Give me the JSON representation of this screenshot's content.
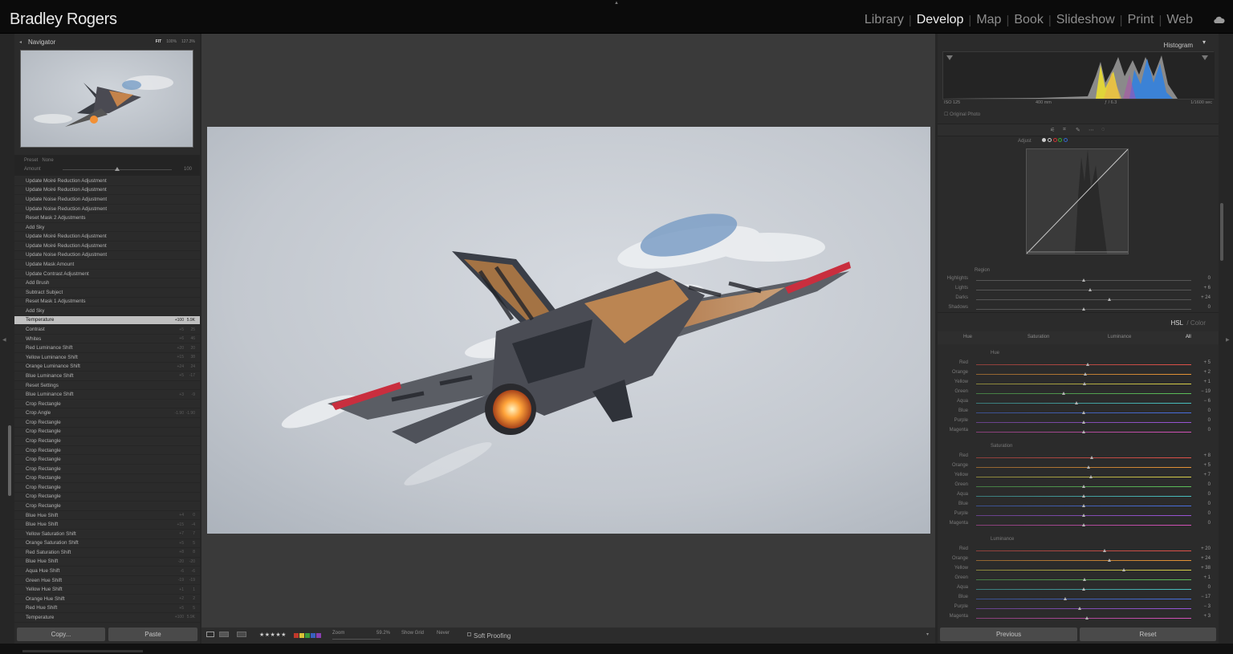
{
  "identity": "Bradley Rogers",
  "modules": [
    {
      "label": "Library",
      "active": false
    },
    {
      "label": "Develop",
      "active": true
    },
    {
      "label": "Map",
      "active": false
    },
    {
      "label": "Book",
      "active": false
    },
    {
      "label": "Slideshow",
      "active": false
    },
    {
      "label": "Print",
      "active": false
    },
    {
      "label": "Web",
      "active": false
    }
  ],
  "navigator": {
    "title": "Navigator",
    "fit": "FIT",
    "zoom1": "100%",
    "zoom2": "127.3%"
  },
  "preset": {
    "label": "Preset",
    "value": "None",
    "amount_label": "Amount",
    "amount_value": "100",
    "amount_fraction": 0.5
  },
  "history": [
    {
      "label": "Update Moiré Reduction Adjustment"
    },
    {
      "label": "Update Moiré Reduction Adjustment"
    },
    {
      "label": "Update Noise Reduction Adjustment"
    },
    {
      "label": "Update Noise Reduction Adjustment"
    },
    {
      "label": "Reset Mask 2 Adjustments"
    },
    {
      "label": "Add Sky"
    },
    {
      "label": "Update Moiré Reduction Adjustment"
    },
    {
      "label": "Update Moiré Reduction Adjustment"
    },
    {
      "label": "Update Noise Reduction Adjustment"
    },
    {
      "label": "Update Mask Amount"
    },
    {
      "label": "Update Contrast Adjustment"
    },
    {
      "label": "Add Brush"
    },
    {
      "label": "Subtract Subject"
    },
    {
      "label": "Reset Mask 1 Adjustments"
    },
    {
      "label": "Add Sky"
    },
    {
      "label": "Temperature",
      "v1": "+100",
      "v2": "5.9K",
      "selected": true
    },
    {
      "label": "Contrast",
      "v1": "+5",
      "v2": "25"
    },
    {
      "label": "Whites",
      "v1": "+6",
      "v2": "46"
    },
    {
      "label": "Red Luminance Shift",
      "v1": "+20",
      "v2": "20"
    },
    {
      "label": "Yellow Luminance Shift",
      "v1": "+15",
      "v2": "38"
    },
    {
      "label": "Orange Luminance Shift",
      "v1": "+24",
      "v2": "24"
    },
    {
      "label": "Blue Luminance Shift",
      "v1": "+5",
      "v2": "-17"
    },
    {
      "label": "Reset Settings"
    },
    {
      "label": "Blue Luminance Shift",
      "v1": "+3",
      "v2": "-9"
    },
    {
      "label": "Crop Rectangle"
    },
    {
      "label": "Crop Angle",
      "v1": "-1.90",
      "v2": "-1.90"
    },
    {
      "label": "Crop Rectangle"
    },
    {
      "label": "Crop Rectangle"
    },
    {
      "label": "Crop Rectangle"
    },
    {
      "label": "Crop Rectangle"
    },
    {
      "label": "Crop Rectangle"
    },
    {
      "label": "Crop Rectangle"
    },
    {
      "label": "Crop Rectangle"
    },
    {
      "label": "Crop Rectangle"
    },
    {
      "label": "Crop Rectangle"
    },
    {
      "label": "Crop Rectangle"
    },
    {
      "label": "Blue Hue Shift",
      "v1": "+4",
      "v2": "0"
    },
    {
      "label": "Blue Hue Shift",
      "v1": "+15",
      "v2": "-4"
    },
    {
      "label": "Yellow Saturation Shift",
      "v1": "+7",
      "v2": "7"
    },
    {
      "label": "Orange Saturation Shift",
      "v1": "+5",
      "v2": "5"
    },
    {
      "label": "Red Saturation Shift",
      "v1": "+8",
      "v2": "8"
    },
    {
      "label": "Blue Hue Shift",
      "v1": "-20",
      "v2": "-20"
    },
    {
      "label": "Aqua Hue Shift",
      "v1": "-6",
      "v2": "-6"
    },
    {
      "label": "Green Hue Shift",
      "v1": "-19",
      "v2": "-19"
    },
    {
      "label": "Yellow Hue Shift",
      "v1": "+1",
      "v2": "1"
    },
    {
      "label": "Orange Hue Shift",
      "v1": "+2",
      "v2": "2"
    },
    {
      "label": "Red Hue Shift",
      "v1": "+5",
      "v2": "5"
    },
    {
      "label": "Temperature",
      "v1": "+100",
      "v2": "5.9K"
    }
  ],
  "buttons": {
    "copy": "Copy...",
    "paste": "Paste",
    "previous": "Previous",
    "reset": "Reset"
  },
  "histogram": {
    "title": "Histogram",
    "iso": "ISO 125",
    "focal": "400 mm",
    "aperture": "ƒ / 6.3",
    "shutter": "1/1600 sec",
    "original_photo": "Original Photo"
  },
  "tone_curve": {
    "adjust": "Adjust",
    "region": "Region",
    "sliders": [
      {
        "label": "Highlights",
        "value": "0",
        "pos": 0.5
      },
      {
        "label": "Lights",
        "value": "+ 6",
        "pos": 0.53
      },
      {
        "label": "Darks",
        "value": "+ 24",
        "pos": 0.62
      },
      {
        "label": "Shadows",
        "value": "0",
        "pos": 0.5
      }
    ]
  },
  "hsl": {
    "title": "HSL",
    "sep": " / ",
    "alt": "Color",
    "tabs": [
      "Hue",
      "Saturation",
      "Luminance",
      "All"
    ],
    "groups": [
      {
        "name": "Hue",
        "rows": [
          {
            "label": "Red",
            "value": "+ 5",
            "pos": 0.52,
            "color": "#e0524a"
          },
          {
            "label": "Orange",
            "value": "+ 2",
            "pos": 0.51,
            "color": "#e79436"
          },
          {
            "label": "Yellow",
            "value": "+ 1",
            "pos": 0.505,
            "color": "#d9d04a"
          },
          {
            "label": "Green",
            "value": "− 19",
            "pos": 0.41,
            "color": "#5cc05a"
          },
          {
            "label": "Aqua",
            "value": "− 6",
            "pos": 0.47,
            "color": "#49c0c0"
          },
          {
            "label": "Blue",
            "value": "0",
            "pos": 0.5,
            "color": "#4a6fe0"
          },
          {
            "label": "Purple",
            "value": "0",
            "pos": 0.5,
            "color": "#9a55d8"
          },
          {
            "label": "Magenta",
            "value": "0",
            "pos": 0.5,
            "color": "#d452b8"
          }
        ]
      },
      {
        "name": "Saturation",
        "rows": [
          {
            "label": "Red",
            "value": "+ 8",
            "pos": 0.54,
            "color": "#e0524a"
          },
          {
            "label": "Orange",
            "value": "+ 5",
            "pos": 0.525,
            "color": "#e79436"
          },
          {
            "label": "Yellow",
            "value": "+ 7",
            "pos": 0.535,
            "color": "#d9d04a"
          },
          {
            "label": "Green",
            "value": "0",
            "pos": 0.5,
            "color": "#5cc05a"
          },
          {
            "label": "Aqua",
            "value": "0",
            "pos": 0.5,
            "color": "#49c0c0"
          },
          {
            "label": "Blue",
            "value": "0",
            "pos": 0.5,
            "color": "#4a6fe0"
          },
          {
            "label": "Purple",
            "value": "0",
            "pos": 0.5,
            "color": "#9a55d8"
          },
          {
            "label": "Magenta",
            "value": "0",
            "pos": 0.5,
            "color": "#d452b8"
          }
        ]
      },
      {
        "name": "Luminance",
        "rows": [
          {
            "label": "Red",
            "value": "+ 20",
            "pos": 0.6,
            "color": "#e0524a"
          },
          {
            "label": "Orange",
            "value": "+ 24",
            "pos": 0.62,
            "color": "#e79436"
          },
          {
            "label": "Yellow",
            "value": "+ 38",
            "pos": 0.69,
            "color": "#d9d04a"
          },
          {
            "label": "Green",
            "value": "+ 1",
            "pos": 0.505,
            "color": "#5cc05a"
          },
          {
            "label": "Aqua",
            "value": "0",
            "pos": 0.5,
            "color": "#49c0c0"
          },
          {
            "label": "Blue",
            "value": "− 17",
            "pos": 0.415,
            "color": "#4a6fe0"
          },
          {
            "label": "Purple",
            "value": "− 3",
            "pos": 0.485,
            "color": "#9a55d8"
          },
          {
            "label": "Magenta",
            "value": "+ 3",
            "pos": 0.515,
            "color": "#d452b8"
          }
        ]
      }
    ]
  },
  "toolbar": {
    "stars": "★★★★★",
    "zoom_label": "Zoom",
    "zoom_value": "59.2%",
    "grid_label": "Show Grid",
    "grid_value": "Never",
    "soft_proofing": "Soft Proofing"
  }
}
